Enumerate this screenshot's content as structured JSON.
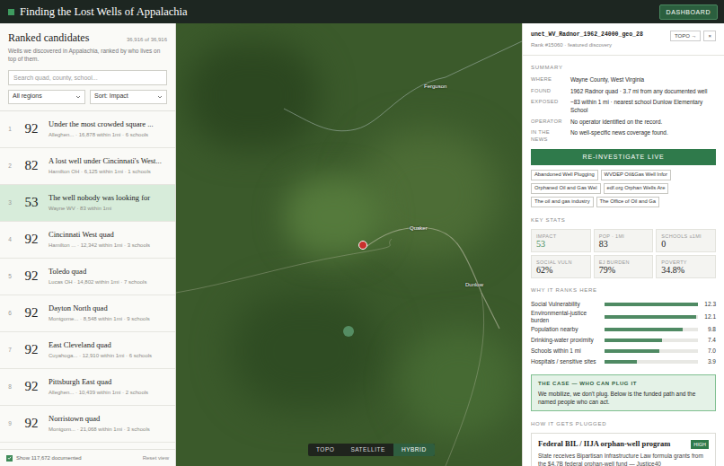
{
  "header": {
    "title": "Finding the Lost Wells of Appalachia",
    "button": "DASHBOARD"
  },
  "list": {
    "title": "Ranked candidates",
    "count": "36,916 of 36,916",
    "subtitle": "Wells we discovered in Appalachia, ranked by who lives on top of them.",
    "search": {
      "placeholder": "Search quad, county, school..."
    },
    "filters": [
      {
        "label": "All regions"
      },
      {
        "label": "Sort: Impact"
      }
    ],
    "rows": [
      {
        "rank": "1",
        "score": "92",
        "title": "Under the most crowded square ...",
        "sub": "Alleghen... · 16,878 within 1mi · 6 schools",
        "selected": false
      },
      {
        "rank": "2",
        "score": "82",
        "title": "A lost well under Cincinnati's West...",
        "sub": "Hamilton OH · 6,125 within 1mi · 1 schools",
        "selected": false
      },
      {
        "rank": "3",
        "score": "53",
        "title": "The well nobody was looking for",
        "sub": "Wayne WV · 83 within 1mi",
        "selected": true
      },
      {
        "rank": "4",
        "score": "92",
        "title": "Cincinnati West quad",
        "sub": "Hamilton ... · 12,342 within 1mi · 3 schools",
        "selected": false
      },
      {
        "rank": "5",
        "score": "92",
        "title": "Toledo quad",
        "sub": "Lucas OH · 14,802 within 1mi · 7 schools",
        "selected": false
      },
      {
        "rank": "6",
        "score": "92",
        "title": "Dayton North quad",
        "sub": "Montgome... · 8,548 within 1mi · 9 schools",
        "selected": false
      },
      {
        "rank": "7",
        "score": "92",
        "title": "East Cleveland quad",
        "sub": "Cuyahoga... · 12,910 within 1mi · 6 schools",
        "selected": false
      },
      {
        "rank": "8",
        "score": "92",
        "title": "Pittsburgh East quad",
        "sub": "Alleghen... · 10,439 within 1mi · 2 schools",
        "selected": false
      },
      {
        "rank": "9",
        "score": "92",
        "title": "Norristown quad",
        "sub": "Montgom... · 21,068 within 1mi · 3 schools",
        "selected": false
      }
    ],
    "footer": {
      "checkbox": {
        "label": "Show 117,672 documented",
        "checked": true
      },
      "reset": "Reset view"
    }
  },
  "map": {
    "labels": [
      "Ferguson",
      "Quaker",
      "Dunlow"
    ],
    "modes": [
      {
        "label": "TOPO",
        "selected": false
      },
      {
        "label": "SATELLITE",
        "selected": false
      },
      {
        "label": "HYBRID",
        "selected": true
      }
    ]
  },
  "detail": {
    "id": "unet_WV_Radnor_1962_24000_geo_28",
    "rank": "Rank #15060 · featured discovery",
    "buttons": [
      "TOPO →",
      "×"
    ],
    "summary": {
      "label": "SUMMARY",
      "rows": [
        {
          "key": "WHERE",
          "value": "Wayne County, West Virginia"
        },
        {
          "key": "FOUND",
          "value": "1962 Radnor quad · 3.7 mi from any documented well"
        },
        {
          "key": "EXPOSED",
          "value": "~83 within 1 mi · nearest school Dunlow Elementary School"
        },
        {
          "key": "OPERATOR",
          "value": "No operator identified on the record."
        },
        {
          "key": "IN THE NEWS",
          "value": "No well-specific news coverage found."
        }
      ]
    },
    "action": "RE-INVESTIGATE LIVE",
    "chips": [
      "Abandoned Well Plugging",
      "WVDEP Oil&Gas Well Infor",
      "Orphaned Oil and Gas Wel",
      "edf.org Orphan Wells Are",
      "The oil and gas industry",
      "The Office of Oil and Ga"
    ],
    "stats": {
      "label": "KEY STATS",
      "items": [
        {
          "label": "IMPACT",
          "value": "53",
          "highlight": true
        },
        {
          "label": "POP · 1MI",
          "value": "83",
          "highlight": false
        },
        {
          "label": "SCHOOLS ≤1MI",
          "value": "0",
          "highlight": false
        },
        {
          "label": "SOCIAL VULN",
          "value": "62%",
          "highlight": false
        },
        {
          "label": "EJ BURDEN",
          "value": "79%",
          "highlight": false
        },
        {
          "label": "POVERTY",
          "value": "34.8%",
          "highlight": false
        }
      ]
    },
    "why": {
      "label": "WHY IT RANKS HERE",
      "bars": [
        {
          "label": "Social Vulnerability",
          "value": "12.3",
          "level": 1.0
        },
        {
          "label": "Environmental-justice burden",
          "value": "12.1",
          "level": 0.98
        },
        {
          "label": "Population nearby",
          "value": "9.8",
          "level": 0.84
        },
        {
          "label": "Drinking-water proximity",
          "value": "7.4",
          "level": 0.62
        },
        {
          "label": "Schools within 1 mi",
          "value": "7.0",
          "level": 0.59
        },
        {
          "label": "Hospitals / sensitive sites",
          "value": "3.9",
          "level": 0.35
        }
      ]
    },
    "case": {
      "title": "THE CASE — WHO CAN PLUG IT",
      "text": "We mobilize, we don't plug. Below is the funded path and the named people who can act."
    },
    "plug": {
      "label": "HOW IT GETS PLUGGED",
      "card": {
        "title": "Federal BIL / IIJA orphan-well program",
        "badge": "HIGH",
        "text": "State receives Bipartisan Infrastructure Law formula grants from the $4.7B federal orphan-well fund — Justice40"
      }
    }
  }
}
